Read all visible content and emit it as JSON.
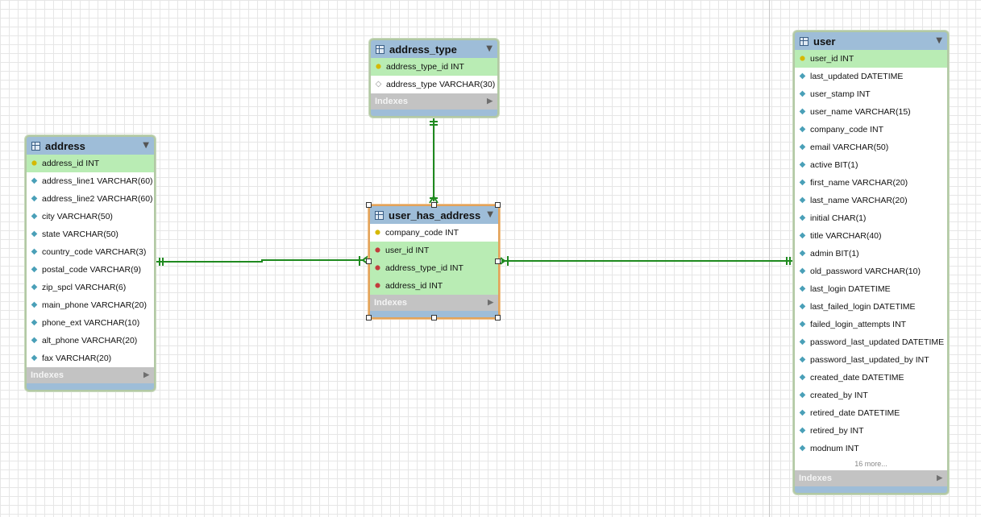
{
  "tables": {
    "address": {
      "name": "address",
      "columns": [
        {
          "text": "address_id INT",
          "kind": "pk"
        },
        {
          "text": "address_line1 VARCHAR(60)",
          "kind": "col"
        },
        {
          "text": "address_line2 VARCHAR(60)",
          "kind": "col"
        },
        {
          "text": "city VARCHAR(50)",
          "kind": "col"
        },
        {
          "text": "state VARCHAR(50)",
          "kind": "col"
        },
        {
          "text": "country_code VARCHAR(3)",
          "kind": "col"
        },
        {
          "text": "postal_code VARCHAR(9)",
          "kind": "col"
        },
        {
          "text": "zip_spcl VARCHAR(6)",
          "kind": "col"
        },
        {
          "text": "main_phone VARCHAR(20)",
          "kind": "col"
        },
        {
          "text": "phone_ext VARCHAR(10)",
          "kind": "col"
        },
        {
          "text": "alt_phone VARCHAR(20)",
          "kind": "col"
        },
        {
          "text": "fax VARCHAR(20)",
          "kind": "col"
        }
      ],
      "indexes_label": "Indexes"
    },
    "address_type": {
      "name": "address_type",
      "columns": [
        {
          "text": "address_type_id INT",
          "kind": "pk"
        },
        {
          "text": "address_type VARCHAR(30)",
          "kind": "colw"
        }
      ],
      "indexes_label": "Indexes"
    },
    "user_has_address": {
      "name": "user_has_address",
      "columns": [
        {
          "text": "company_code INT",
          "kind": "key"
        },
        {
          "text": "user_id INT",
          "kind": "fk"
        },
        {
          "text": "address_type_id INT",
          "kind": "fk"
        },
        {
          "text": "address_id INT",
          "kind": "fk"
        }
      ],
      "indexes_label": "Indexes"
    },
    "user": {
      "name": "user",
      "columns": [
        {
          "text": "user_id INT",
          "kind": "pk"
        },
        {
          "text": "last_updated DATETIME",
          "kind": "col"
        },
        {
          "text": "user_stamp INT",
          "kind": "col"
        },
        {
          "text": "user_name VARCHAR(15)",
          "kind": "col"
        },
        {
          "text": "company_code INT",
          "kind": "col"
        },
        {
          "text": "email VARCHAR(50)",
          "kind": "col"
        },
        {
          "text": "active BIT(1)",
          "kind": "col"
        },
        {
          "text": "first_name VARCHAR(20)",
          "kind": "col"
        },
        {
          "text": "last_name VARCHAR(20)",
          "kind": "col"
        },
        {
          "text": "initial CHAR(1)",
          "kind": "col"
        },
        {
          "text": "title VARCHAR(40)",
          "kind": "col"
        },
        {
          "text": "admin BIT(1)",
          "kind": "col"
        },
        {
          "text": "old_password VARCHAR(10)",
          "kind": "col"
        },
        {
          "text": "last_login DATETIME",
          "kind": "col"
        },
        {
          "text": "last_failed_login DATETIME",
          "kind": "col"
        },
        {
          "text": "failed_login_attempts INT",
          "kind": "col"
        },
        {
          "text": "password_last_updated DATETIME",
          "kind": "col"
        },
        {
          "text": "password_last_updated_by INT",
          "kind": "col"
        },
        {
          "text": "created_date DATETIME",
          "kind": "col"
        },
        {
          "text": "created_by INT",
          "kind": "col"
        },
        {
          "text": "retired_date DATETIME",
          "kind": "col"
        },
        {
          "text": "retired_by INT",
          "kind": "col"
        },
        {
          "text": "modnum INT",
          "kind": "col"
        }
      ],
      "more_label": "16 more...",
      "indexes_label": "Indexes"
    }
  },
  "icons": {
    "table": "table-icon",
    "dropdown": "▼",
    "expand": "▶",
    "pk": "🔑",
    "fk": "🔑",
    "col": "◆",
    "colw": "◇"
  },
  "colors": {
    "header": "#9ebdd8",
    "pk_row": "#b9ecb4",
    "relationship": "#1f8a1f"
  }
}
